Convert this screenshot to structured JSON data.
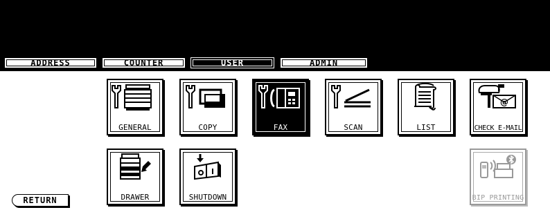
{
  "tabs": [
    {
      "label": "ADDRESS",
      "active": false
    },
    {
      "label": "COUNTER",
      "active": false
    },
    {
      "label": "USER",
      "active": true
    },
    {
      "label": "ADMIN",
      "active": false
    }
  ],
  "menu": {
    "general": {
      "label": "GENERAL",
      "icon": "wrench-copier-icon"
    },
    "copy": {
      "label": "COPY",
      "icon": "wrench-copy-icon"
    },
    "fax": {
      "label": "FAX",
      "icon": "wrench-fax-icon",
      "selected": true
    },
    "scan": {
      "label": "SCAN",
      "icon": "wrench-scan-icon"
    },
    "list": {
      "label": "LIST",
      "icon": "document-list-icon"
    },
    "check_email": {
      "label": "CHECK E-MAIL",
      "icon": "mailbox-icon"
    },
    "drawer": {
      "label": "DRAWER",
      "icon": "copier-drawer-icon"
    },
    "shutdown": {
      "label": "SHUTDOWN",
      "icon": "power-switch-icon"
    },
    "bip_printing": {
      "label": "BIP PRINTING",
      "icon": "bluetooth-printer-icon",
      "disabled": true
    }
  },
  "return_label": "RETURN"
}
